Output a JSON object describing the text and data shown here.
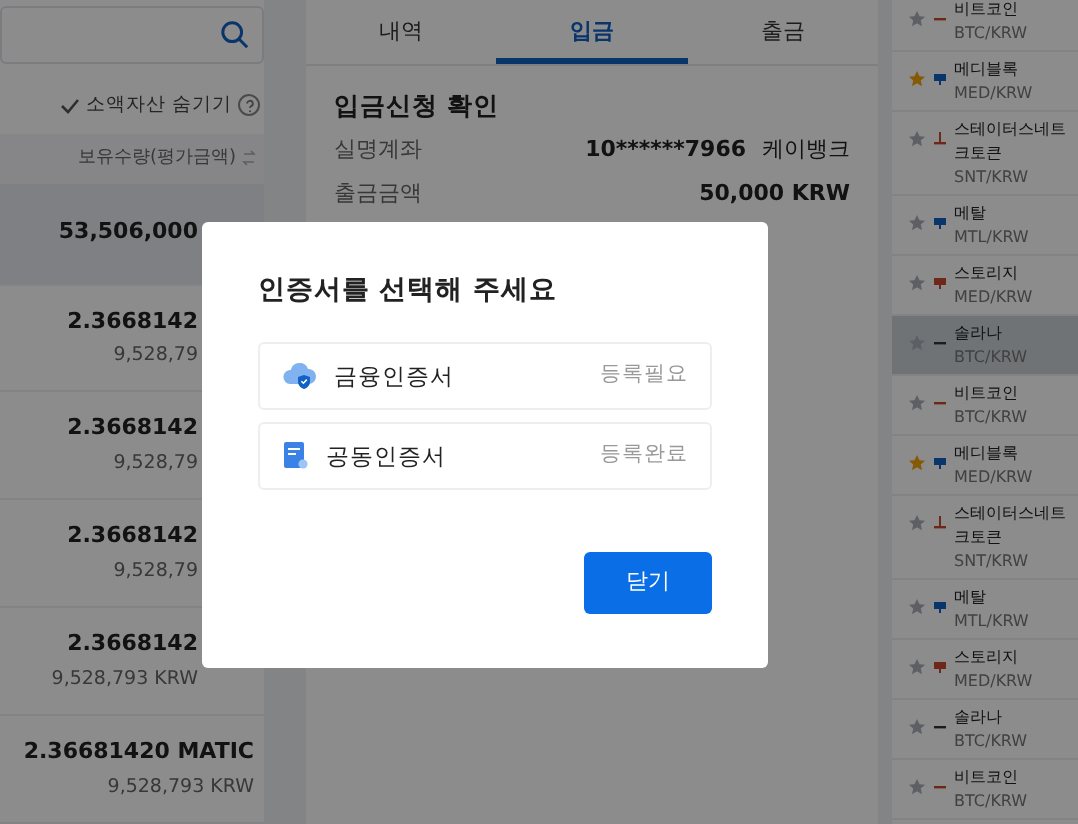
{
  "assets": {
    "hide_small_assets": {
      "label": "소액자산 숨기기",
      "checked": true
    },
    "column_header": "보유수량(평가금액)",
    "rows": [
      {
        "amount": "53,506,000",
        "selected": true
      },
      {
        "amount": "2.3668142",
        "value": "9,528,79",
        "selected": false
      },
      {
        "amount": "2.3668142",
        "value": "9,528,79",
        "selected": false
      },
      {
        "amount": "2.3668142",
        "value": "9,528,79",
        "selected": false
      },
      {
        "amount": "2.3668142",
        "value": "9,528,793 KRW",
        "selected": false
      },
      {
        "amount": "2.36681420 MATIC",
        "value": "9,528,793 KRW",
        "selected": false
      }
    ]
  },
  "transfer": {
    "tabs": [
      {
        "label": "내역",
        "selected": false
      },
      {
        "label": "입금",
        "selected": true
      },
      {
        "label": "출금",
        "selected": false
      }
    ],
    "section_title": "입금신청 확인",
    "fields": [
      {
        "label": "실명계좌",
        "value": "10******7966",
        "bank": "케이뱅크"
      },
      {
        "label": "출금금액",
        "value": "50,000 KRW"
      }
    ]
  },
  "markets": [
    {
      "name_lines": [
        "비트코인"
      ],
      "pair": "BTC/KRW",
      "starred": false,
      "kind": "flatrise",
      "selected": false
    },
    {
      "name_lines": [
        "메디블록"
      ],
      "pair": "MED/KRW",
      "starred": true,
      "kind": "fall",
      "selected": false
    },
    {
      "name_lines": [
        "스테이터스네트",
        "크토큰"
      ],
      "pair": "SNT/KRW",
      "starred": false,
      "kind": "risecross",
      "selected": false
    },
    {
      "name_lines": [
        "메탈"
      ],
      "pair": "MTL/KRW",
      "starred": false,
      "kind": "fall",
      "selected": false
    },
    {
      "name_lines": [
        "스토리지"
      ],
      "pair": "MED/KRW",
      "starred": false,
      "kind": "rise",
      "selected": false
    },
    {
      "name_lines": [
        "솔라나"
      ],
      "pair": "BTC/KRW",
      "starred": false,
      "kind": "flat",
      "selected": true
    },
    {
      "name_lines": [
        "비트코인"
      ],
      "pair": "BTC/KRW",
      "starred": false,
      "kind": "flatrise",
      "selected": false
    },
    {
      "name_lines": [
        "메디블록"
      ],
      "pair": "MED/KRW",
      "starred": true,
      "kind": "fall",
      "selected": false
    },
    {
      "name_lines": [
        "스테이터스네트",
        "크토큰"
      ],
      "pair": "SNT/KRW",
      "starred": false,
      "kind": "risecross",
      "selected": false
    },
    {
      "name_lines": [
        "메탈"
      ],
      "pair": "MTL/KRW",
      "starred": false,
      "kind": "fall",
      "selected": false
    },
    {
      "name_lines": [
        "스토리지"
      ],
      "pair": "MED/KRW",
      "starred": false,
      "kind": "rise",
      "selected": false
    },
    {
      "name_lines": [
        "솔라나"
      ],
      "pair": "BTC/KRW",
      "starred": false,
      "kind": "flat",
      "selected": false
    },
    {
      "name_lines": [
        "비트코인"
      ],
      "pair": "BTC/KRW",
      "starred": false,
      "kind": "flatrise",
      "selected": false
    }
  ],
  "dialog": {
    "title": "인증서를 선택해 주세요",
    "options": [
      {
        "kind": "cloud",
        "label": "금융인증서",
        "status": "등록필요"
      },
      {
        "kind": "document",
        "label": "공동인증서",
        "status": "등록완료"
      }
    ],
    "close_button": "닫기"
  }
}
